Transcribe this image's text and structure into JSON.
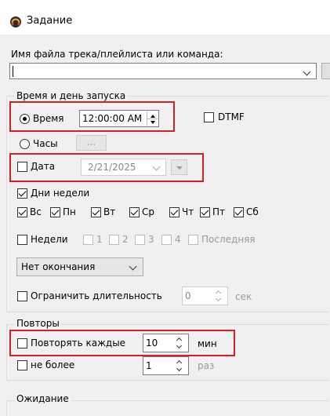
{
  "window": {
    "title": "Задание",
    "icon": "headphones-icon"
  },
  "track": {
    "label": "Имя файла трека/плейлиста или команда:",
    "value": "",
    "side_button": "..."
  },
  "launch": {
    "legend": "Время и день запуска",
    "time_radio": "Время",
    "time_value": "12:00:00 AM",
    "dtmf": "DTMF",
    "hours_radio": "Часы",
    "hours_button": "...",
    "date_check": "Дата",
    "date_value": "2/21/2025",
    "weekdays_check": "Дни недели",
    "days": [
      "Вс",
      "Пн",
      "Вт",
      "Ср",
      "Чт",
      "Пт",
      "Сб"
    ],
    "weeks_check": "Недели",
    "weeks": [
      "1",
      "2",
      "3",
      "4",
      "Последняя"
    ],
    "end_select": "Нет окончания",
    "limit_check": "Ограничить длительность",
    "limit_value": "0",
    "limit_unit": "сек"
  },
  "repeat": {
    "legend": "Повторы",
    "every_check": "Повторять каждые",
    "every_value": "10",
    "every_unit": "мин",
    "max_check": "не более",
    "max_value": "1",
    "max_unit": "раз"
  },
  "wait": {
    "legend": "Ожидание"
  },
  "colors": {
    "highlight": "#d62020",
    "background": "#f0f0f0"
  }
}
